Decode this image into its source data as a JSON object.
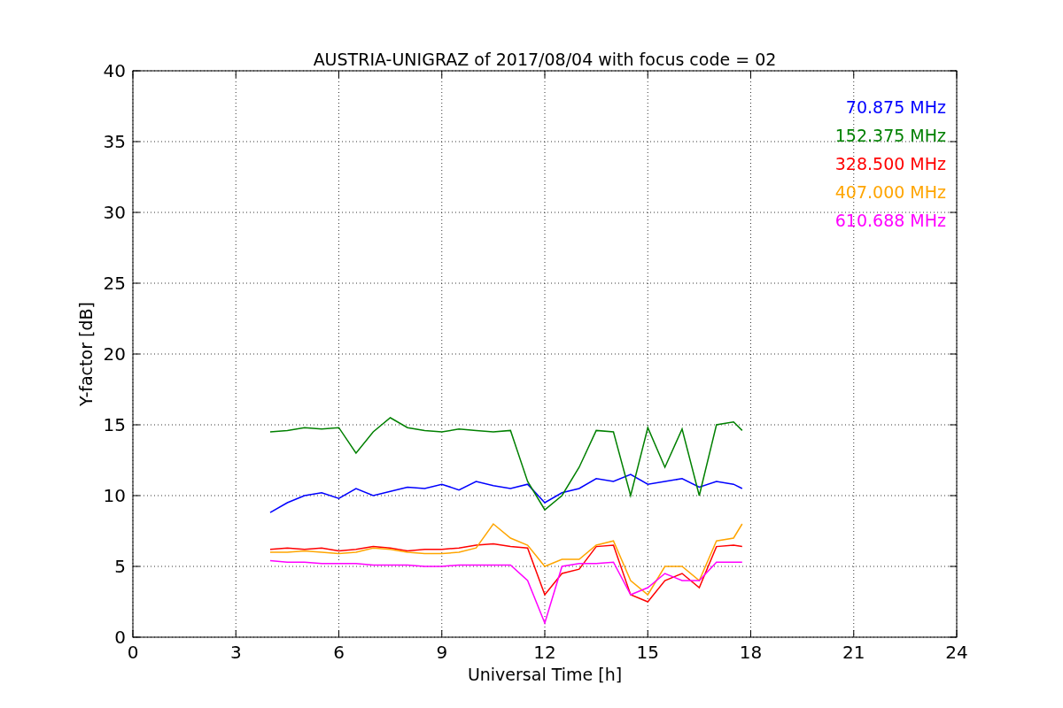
{
  "figure": {
    "chart_data": {
      "type": "line",
      "title": "AUSTRIA-UNIGRAZ of 2017/08/04 with focus code = 02",
      "xlabel": "Universal Time [h]",
      "ylabel": "Y-factor [dB]",
      "x": [
        4,
        4.5,
        5,
        5.5,
        6,
        6.5,
        7,
        7.5,
        8,
        8.5,
        9,
        9.5,
        10,
        10.5,
        11,
        11.5,
        12,
        12.5,
        13,
        13.5,
        14,
        14.5,
        15,
        15.5,
        16,
        16.5,
        17,
        17.5,
        17.75
      ],
      "series": [
        {
          "name": "70.875 MHz",
          "color": "#0000ff",
          "values": [
            8.8,
            9.5,
            10,
            10.2,
            9.8,
            10.5,
            10,
            10.3,
            10.6,
            10.5,
            10.8,
            10.4,
            11,
            10.7,
            10.5,
            10.8,
            9.5,
            10.2,
            10.5,
            11.2,
            11,
            11.5,
            10.8,
            11,
            11.2,
            10.6,
            11,
            10.8,
            10.5
          ]
        },
        {
          "name": "152.375 MHz",
          "color": "#008000",
          "values": [
            14.5,
            14.6,
            14.8,
            14.7,
            14.8,
            13,
            14.5,
            15.5,
            14.8,
            14.6,
            14.5,
            14.7,
            14.6,
            14.5,
            14.6,
            11,
            9,
            10,
            12,
            14.6,
            14.5,
            10,
            14.8,
            12,
            14.7,
            10,
            15,
            15.2,
            14.6
          ]
        },
        {
          "name": "328.500 MHz",
          "color": "#ff0000",
          "values": [
            6.2,
            6.3,
            6.2,
            6.3,
            6.1,
            6.2,
            6.4,
            6.3,
            6.1,
            6.2,
            6.2,
            6.3,
            6.5,
            6.6,
            6.4,
            6.3,
            3,
            4.5,
            4.8,
            6.4,
            6.5,
            3,
            2.5,
            4,
            4.5,
            3.5,
            6.4,
            6.5,
            6.4
          ]
        },
        {
          "name": "407.000 MHz",
          "color": "#ffa500",
          "values": [
            6,
            6,
            6.1,
            6,
            5.9,
            6,
            6.3,
            6.2,
            6,
            5.9,
            5.9,
            6,
            6.3,
            8,
            7,
            6.5,
            5,
            5.5,
            5.5,
            6.5,
            6.8,
            4,
            3,
            5,
            5,
            4,
            6.8,
            7,
            8
          ]
        },
        {
          "name": "610.688 MHz",
          "color": "#ff00ff",
          "values": [
            5.4,
            5.3,
            5.3,
            5.2,
            5.2,
            5.2,
            5.1,
            5.1,
            5.1,
            5,
            5,
            5.1,
            5.1,
            5.1,
            5.1,
            4,
            1,
            5,
            5.2,
            5.2,
            5.3,
            3,
            3.5,
            4.5,
            4,
            4,
            5.3,
            5.3,
            5.3
          ]
        }
      ],
      "grid": true,
      "xlim": [
        0,
        24
      ],
      "ylim": [
        0,
        40
      ],
      "xticks": [
        0,
        3,
        6,
        9,
        12,
        15,
        18,
        21,
        24
      ],
      "yticks": [
        0,
        5,
        10,
        15,
        20,
        25,
        30,
        35,
        40
      ]
    }
  }
}
